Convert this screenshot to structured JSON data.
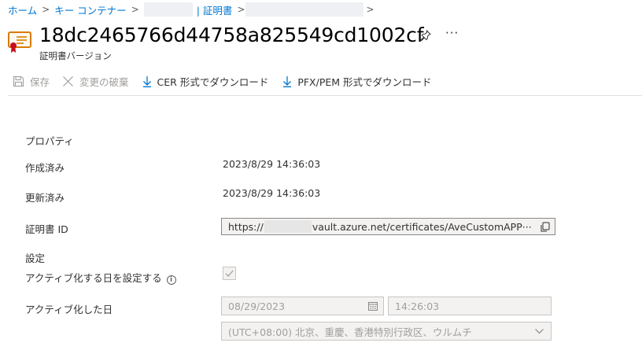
{
  "breadcrumb": {
    "items": [
      "ホーム",
      "キー コンテナー",
      "| 証明書"
    ],
    "separator": ">"
  },
  "header": {
    "title": "18dc2465766d44758a825549cd1002cf",
    "subtitle": "証明書バージョン",
    "pin_icon": "pin-icon",
    "more_label": "···"
  },
  "toolbar": {
    "save_label": "保存",
    "discard_label": "変更の破棄",
    "download_cer_label": "CER 形式でダウンロード",
    "download_pfx_label": "PFX/PEM 形式でダウンロード"
  },
  "properties": {
    "section_title": "プロパティ",
    "created_label": "作成済み",
    "created_value": "2023/8/29 14:36:03",
    "updated_label": "更新済み",
    "updated_value": "2023/8/29 14:36:03",
    "cert_id_label": "証明書 ID",
    "cert_id_prefix": "https://",
    "cert_id_suffix": "vault.azure.net/certificates/AveCustomAPP···"
  },
  "settings": {
    "section_title": "設定",
    "set_activation_label": "アクティブ化する日を設定する",
    "set_activation_checked": true,
    "activation_date_label": "アクティブ化した日",
    "activation_date_value": "08/29/2023",
    "activation_time_value": "14:26:03",
    "timezone_value": "(UTC+08:00) 北京、重慶、香港特別行政区、ウルムチ"
  },
  "colors": {
    "link": "#0078d4",
    "text": "#323130",
    "disabled_text": "#a19f9d",
    "certificate_icon": "#d97b00"
  }
}
